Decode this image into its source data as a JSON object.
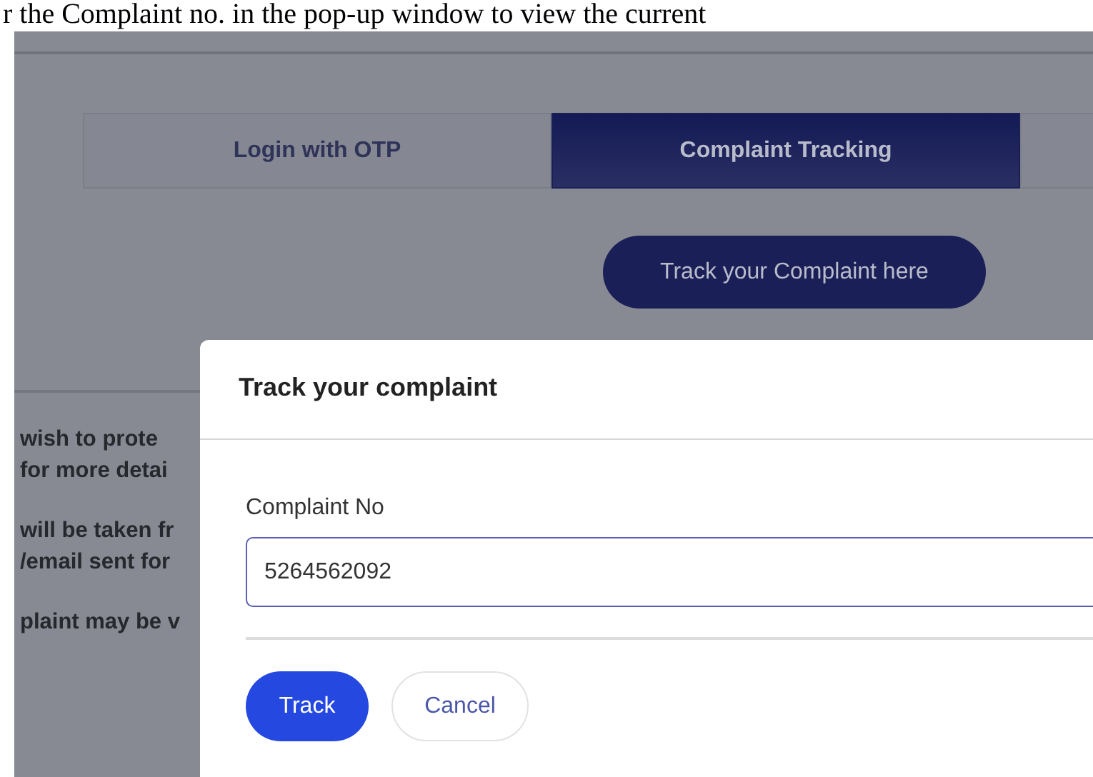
{
  "caption": "r the Complaint no. in the pop-up window to view the current",
  "tabs": [
    {
      "label": "Login with OTP",
      "selected": false
    },
    {
      "label": "Complaint Tracking",
      "selected": true
    },
    {
      "selected": false
    }
  ],
  "track_link": "Track your Complaint here",
  "background_text": [
    [
      "wish to prote",
      "for more detai"
    ],
    [
      "will be taken fr",
      "/email sent for"
    ],
    [
      "plaint may be v"
    ]
  ],
  "modal": {
    "title": "Track your complaint",
    "field_label": "Complaint No",
    "value": "5264562092",
    "buttons": [
      {
        "label": "Track",
        "kind": "primary"
      },
      {
        "label": "Cancel",
        "kind": "secondary"
      }
    ]
  }
}
